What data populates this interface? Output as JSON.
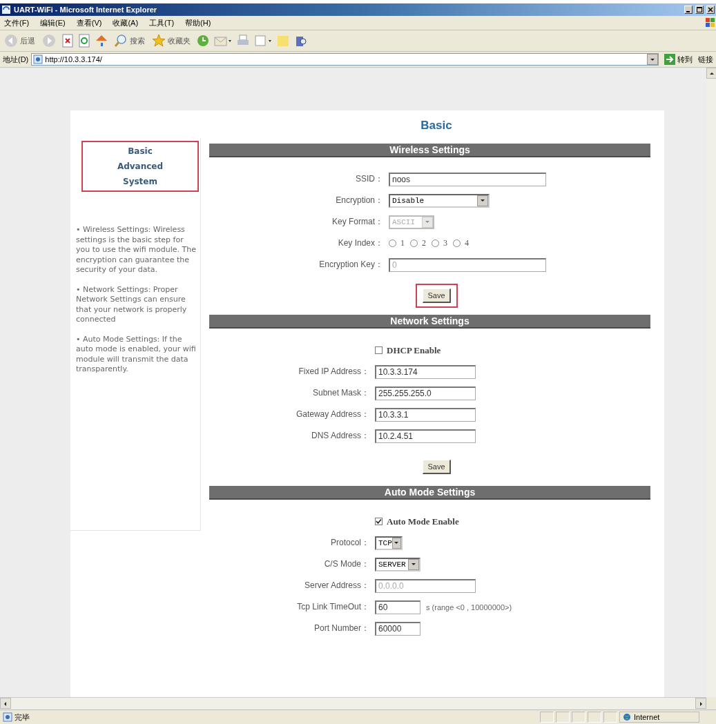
{
  "window": {
    "title": "UART-WiFi - Microsoft Internet Explorer"
  },
  "menu": [
    "文件(F)",
    "编辑(E)",
    "查看(V)",
    "收藏(A)",
    "工具(T)",
    "帮助(H)"
  ],
  "toolbar": {
    "back_label": "后退",
    "search_label": "搜索",
    "favorites_label": "收藏夹"
  },
  "address_bar": {
    "label": "地址(D)",
    "url": "http://10.3.3.174/",
    "go_label": "转到",
    "links_label": "链接"
  },
  "page": {
    "title": "Basic",
    "nav": {
      "highlighted": true,
      "items": [
        "Basic",
        "Advanced",
        "System"
      ]
    },
    "help": [
      "• Wireless Settings: Wireless settings is the basic step for you to use the wifi module. The encryption can guarantee the security of your data.",
      "• Network Settings: Proper Network Settings can ensure that your network is properly connected",
      "• Auto Mode Settings: If the auto mode is enabled, your wifi module will transmit the data transparently."
    ],
    "sections": [
      {
        "title": "Wireless Settings",
        "rows": [
          {
            "kind": "text",
            "label": "SSID：",
            "value": "noos",
            "disabled": false
          },
          {
            "kind": "select",
            "label": "Encryption：",
            "value": "Disable",
            "disabled": false
          },
          {
            "kind": "select",
            "label": "Key Format：",
            "value": "ASCII",
            "disabled": true
          },
          {
            "kind": "radio",
            "label": "Key Index：",
            "options": [
              {
                "label": "1",
                "selected": false
              },
              {
                "label": "2",
                "selected": false
              },
              {
                "label": "3",
                "selected": false
              },
              {
                "label": "4",
                "selected": false
              }
            ]
          },
          {
            "kind": "text",
            "label": "Encryption Key：",
            "value": "0",
            "disabled": true
          }
        ],
        "save": {
          "label": "Save",
          "highlighted": true
        }
      },
      {
        "title": "Network Settings",
        "rows": [
          {
            "kind": "checkbox",
            "label": "DHCP Enable",
            "checked": false
          },
          {
            "kind": "text",
            "label": "Fixed IP Address：",
            "value": "10.3.3.174",
            "disabled": false
          },
          {
            "kind": "text",
            "label": "Subnet Mask：",
            "value": "255.255.255.0",
            "disabled": false
          },
          {
            "kind": "text",
            "label": "Gateway Address：",
            "value": "10.3.3.1",
            "disabled": false
          },
          {
            "kind": "text",
            "label": "DNS Address：",
            "value": "10.2.4.51",
            "disabled": false
          }
        ],
        "save": {
          "label": "Save",
          "highlighted": false
        }
      },
      {
        "title": "Auto Mode Settings",
        "rows": [
          {
            "kind": "checkbox",
            "label": "Auto Mode Enable",
            "checked": true
          },
          {
            "kind": "select",
            "label": "Protocol：",
            "value": "TCP",
            "disabled": false
          },
          {
            "kind": "select",
            "label": "C/S Mode：",
            "value": "SERVER",
            "disabled": false
          },
          {
            "kind": "text",
            "label": "Server Address：",
            "value": "0.0.0.0",
            "disabled": true
          },
          {
            "kind": "text",
            "label": "Tcp Link TimeOut：",
            "value": "60",
            "disabled": false,
            "note": "s (range <0 , 10000000>)"
          },
          {
            "kind": "text",
            "label": "Port Number：",
            "value": "60000",
            "disabled": false
          }
        ]
      }
    ]
  },
  "status_bar": {
    "text": "完毕",
    "zone": "Internet"
  }
}
